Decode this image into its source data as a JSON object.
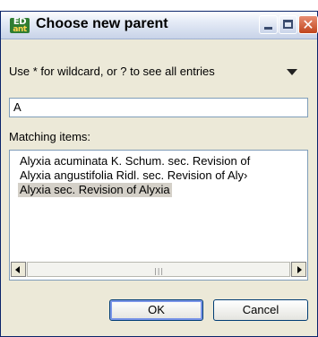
{
  "window": {
    "title": "Choose new parent",
    "icon": "app-icon",
    "icon_text_top": "ED",
    "icon_text_bottom": "ant",
    "close_glyph": "✕",
    "colors": {
      "close": "#c0451d",
      "frame": "#0a246a"
    }
  },
  "hint": {
    "text": "Use * for wildcard, or ? to see all entries"
  },
  "search": {
    "value": "A"
  },
  "matching": {
    "label": "Matching items:",
    "items": [
      "Alyxia acuminata K. Schum. sec. Revision of",
      "Alyxia angustifolia Ridl. sec. Revision of Aly›",
      "Alyxia sec. Revision of Alyxia"
    ],
    "selected_index": 2,
    "scroll_grip": "|||"
  },
  "buttons": {
    "ok": "OK",
    "cancel": "Cancel"
  }
}
